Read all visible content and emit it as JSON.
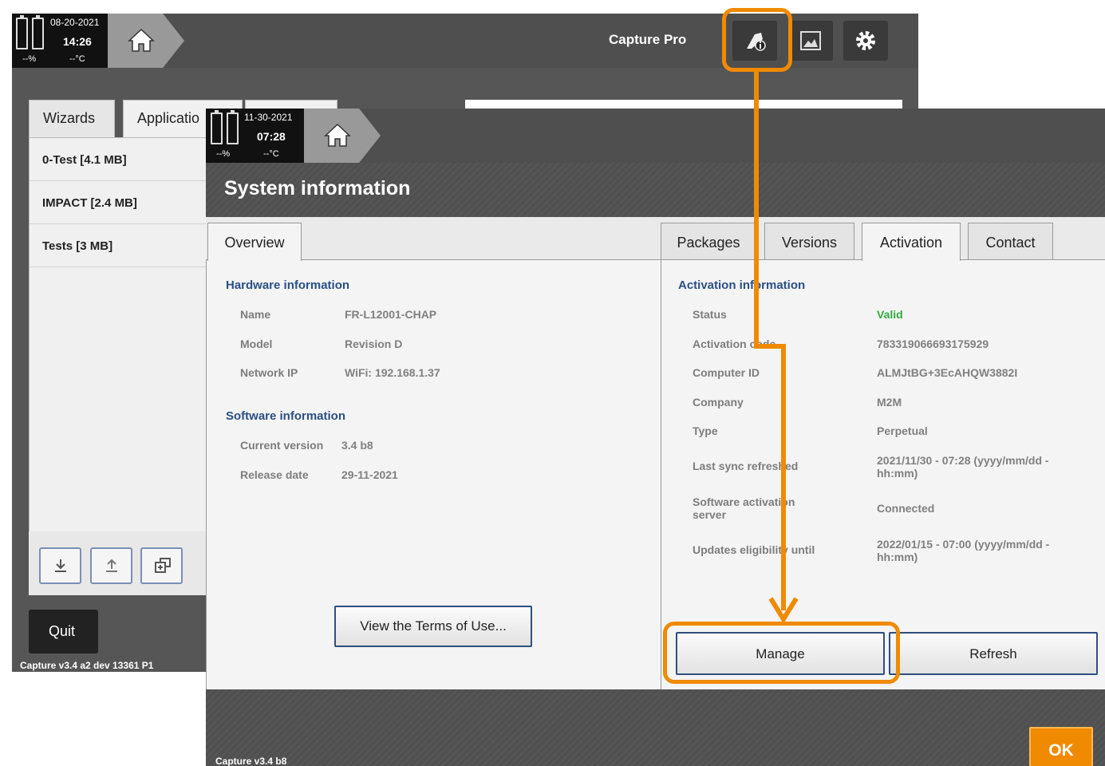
{
  "colors": {
    "accent": "#f08a00",
    "valid": "#32a840",
    "section": "#2a4f84",
    "toolbar": "#4f4f4f"
  },
  "back": {
    "status": {
      "date": "08-20-2021",
      "time": "14:26",
      "battery": "--%",
      "temp": "--°C"
    },
    "title": "Capture Pro",
    "toolbar_icons": [
      "info-icon",
      "gallery-icon",
      "gear-icon"
    ],
    "tabs": [
      "Wizards",
      "Applicatio"
    ],
    "list": [
      "0-Test [4.1  MB]",
      "IMPACT [2.4  MB]",
      "Tests [3  MB]"
    ],
    "list_tool_icons": [
      "download-icon",
      "upload-icon",
      "duplicate-icon"
    ],
    "quit": "Quit",
    "version": "Capture v3.4 a2 dev 13361 P1"
  },
  "front": {
    "status": {
      "date": "11-30-2021",
      "time": "07:28",
      "battery": "--%",
      "temp": "--°C"
    },
    "title": "System information",
    "left_tab": "Overview",
    "right_tabs": [
      "Packages",
      "Versions",
      "Activation",
      "Contact"
    ],
    "active_right_tab": "Activation",
    "hardware": {
      "heading": "Hardware information",
      "rows": [
        {
          "label": "Name",
          "value": "FR-L12001-CHAP"
        },
        {
          "label": "Model",
          "value": "Revision D"
        },
        {
          "label": "Network IP",
          "value": "WiFi: 192.168.1.37"
        }
      ]
    },
    "software": {
      "heading": "Software information",
      "rows": [
        {
          "label": "Current version",
          "value": "3.4 b8"
        },
        {
          "label": "Release date",
          "value": "29-11-2021"
        }
      ]
    },
    "terms_button": "View the Terms of Use...",
    "activation": {
      "heading": "Activation information",
      "rows": [
        {
          "label": "Status",
          "value": "Valid"
        },
        {
          "label": "Activation code",
          "value": "783319066693175929"
        },
        {
          "label": "Computer ID",
          "value": "ALMJtBG+3EcAHQW3882I"
        },
        {
          "label": "Company",
          "value": "M2M"
        },
        {
          "label": "Type",
          "value": "Perpetual"
        },
        {
          "label": "Last sync refreshed",
          "value": "2021/11/30 - 07:28 (yyyy/mm/dd - hh:mm)"
        },
        {
          "label": "Software activation server",
          "value": "Connected"
        },
        {
          "label": "Updates eligibility until",
          "value": "2022/01/15 - 07:00 (yyyy/mm/dd - hh:mm)"
        }
      ]
    },
    "manage": "Manage",
    "refresh": "Refresh",
    "ok": "OK",
    "version": "Capture v3.4 b8"
  }
}
